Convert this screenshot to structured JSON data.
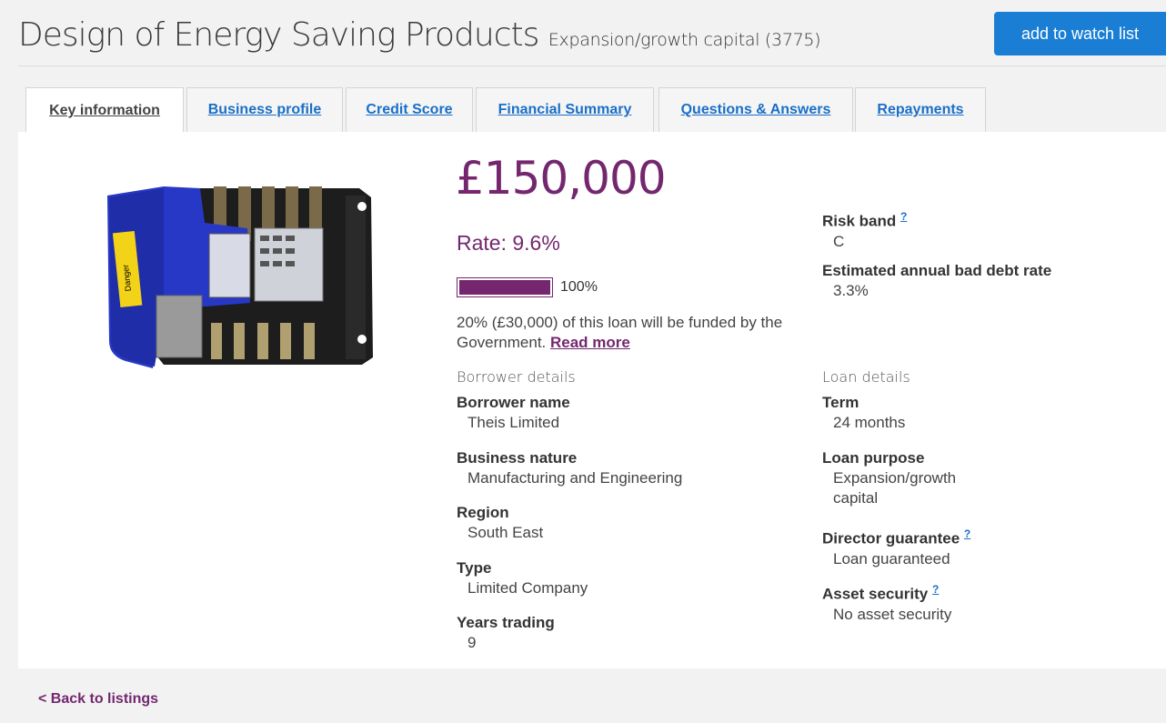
{
  "header": {
    "title": "Design of Energy Saving Products",
    "subtitle": "Expansion/growth capital (3775)",
    "watch_button": "add to watch list"
  },
  "tabs": [
    {
      "label": "Key information",
      "active": true
    },
    {
      "label": "Business profile",
      "active": false
    },
    {
      "label": "Credit Score",
      "active": false
    },
    {
      "label": "Financial Summary",
      "active": false
    },
    {
      "label": "Questions & Answers",
      "active": false
    },
    {
      "label": "Repayments",
      "active": false
    }
  ],
  "loan": {
    "amount": "£150,000",
    "rate": "Rate: 9.6%",
    "progress_label": "100%",
    "progress_fraction": 1.0,
    "gov_text": "20% (£30,000) of this loan will be funded by the Government.",
    "read_more": "Read more"
  },
  "risk": {
    "risk_band_label": "Risk band",
    "risk_band_value": "C",
    "bad_debt_label": "Estimated annual bad debt rate",
    "bad_debt_value": "3.3%"
  },
  "borrower": {
    "section_title": "Borrower details",
    "fields": [
      {
        "label": "Borrower name",
        "value": "Theis Limited"
      },
      {
        "label": "Business nature",
        "value": "Manufacturing and Engineering"
      },
      {
        "label": "Region",
        "value": "South East"
      },
      {
        "label": "Type",
        "value": "Limited Company"
      },
      {
        "label": "Years trading",
        "value": "9"
      }
    ]
  },
  "loan_details": {
    "section_title": "Loan details",
    "term_label": "Term",
    "term_value": "24 months",
    "purpose_label": "Loan purpose",
    "purpose_value": "Expansion/growth capital",
    "guarantee_label": "Director guarantee",
    "guarantee_value": "Loan guaranteed",
    "security_label": "Asset security",
    "security_value": "No asset security",
    "help_glyph": "?"
  },
  "photo": {
    "warning_text": "Danger"
  },
  "nav": {
    "back": "< Back to listings"
  },
  "colors": {
    "accent_purple": "#74276f",
    "link_blue": "#1a6fc7",
    "button_blue": "#1a7fd4"
  }
}
